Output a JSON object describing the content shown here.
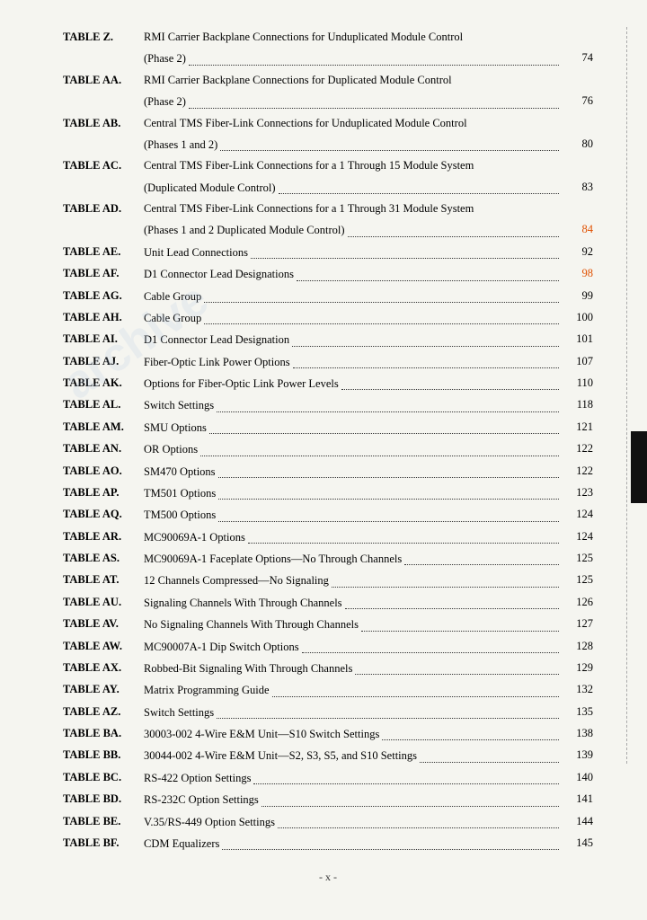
{
  "page": {
    "footer": "- x -",
    "watermark": "archive",
    "entries": [
      {
        "label": "TABLE Z.",
        "desc": "RMI Carrier Backplane Connections for Unduplicated Module Control",
        "desc2": "(Phase 2)",
        "page": "74",
        "highlight": false
      },
      {
        "label": "TABLE AA.",
        "desc": "RMI Carrier Backplane Connections for Duplicated Module Control",
        "desc2": "(Phase 2)",
        "page": "76",
        "highlight": false
      },
      {
        "label": "TABLE AB.",
        "desc": "Central TMS Fiber-Link Connections for Unduplicated Module Control",
        "desc2": "(Phases 1 and 2)",
        "page": "80",
        "highlight": false
      },
      {
        "label": "TABLE AC.",
        "desc": "Central TMS Fiber-Link Connections for a 1 Through 15 Module System",
        "desc2": "(Duplicated Module Control)",
        "page": "83",
        "highlight": false
      },
      {
        "label": "TABLE AD.",
        "desc": "Central TMS Fiber-Link Connections for a 1 Through 31 Module System",
        "desc2": "(Phases 1 and 2 Duplicated Module Control)",
        "page": "84",
        "highlight": true
      },
      {
        "label": "TABLE AE.",
        "desc": "Unit Lead Connections",
        "desc2": null,
        "page": "92",
        "highlight": false
      },
      {
        "label": "TABLE AF.",
        "desc": "D1 Connector Lead Designations",
        "desc2": null,
        "page": "98",
        "highlight": true
      },
      {
        "label": "TABLE AG.",
        "desc": "Cable Group",
        "desc2": null,
        "page": "99",
        "highlight": false
      },
      {
        "label": "TABLE AH.",
        "desc": "Cable Group",
        "desc2": null,
        "page": "100",
        "highlight": false
      },
      {
        "label": "TABLE AI.",
        "desc": "D1 Connector Lead Designation",
        "desc2": null,
        "page": "101",
        "highlight": false
      },
      {
        "label": "TABLE AJ.",
        "desc": "Fiber-Optic Link Power Options",
        "desc2": null,
        "page": "107",
        "highlight": false
      },
      {
        "label": "TABLE AK.",
        "desc": "Options for Fiber-Optic Link Power Levels",
        "desc2": null,
        "page": "110",
        "highlight": false
      },
      {
        "label": "TABLE AL.",
        "desc": "Switch Settings",
        "desc2": null,
        "page": "118",
        "highlight": false
      },
      {
        "label": "TABLE AM.",
        "desc": "SMU Options",
        "desc2": null,
        "page": "121",
        "highlight": false
      },
      {
        "label": "TABLE AN.",
        "desc": "OR Options",
        "desc2": null,
        "page": "122",
        "highlight": false
      },
      {
        "label": "TABLE AO.",
        "desc": "SM470 Options",
        "desc2": null,
        "page": "122",
        "highlight": false
      },
      {
        "label": "TABLE AP.",
        "desc": "TM501 Options",
        "desc2": null,
        "page": "123",
        "highlight": false
      },
      {
        "label": "TABLE AQ.",
        "desc": "TM500 Options",
        "desc2": null,
        "page": "124",
        "highlight": false
      },
      {
        "label": "TABLE AR.",
        "desc": "MC90069A-1 Options",
        "desc2": null,
        "page": "124",
        "highlight": false
      },
      {
        "label": "TABLE AS.",
        "desc": "MC90069A-1 Faceplate Options—No Through Channels",
        "desc2": null,
        "page": "125",
        "highlight": false
      },
      {
        "label": "TABLE AT.",
        "desc": "12 Channels Compressed—No Signaling",
        "desc2": null,
        "page": "125",
        "highlight": false
      },
      {
        "label": "TABLE AU.",
        "desc": "Signaling Channels With Through Channels",
        "desc2": null,
        "page": "126",
        "highlight": false
      },
      {
        "label": "TABLE AV.",
        "desc": "No Signaling Channels With Through Channels",
        "desc2": null,
        "page": "127",
        "highlight": false
      },
      {
        "label": "TABLE AW.",
        "desc": "MC90007A-1 Dip Switch Options",
        "desc2": null,
        "page": "128",
        "highlight": false
      },
      {
        "label": "TABLE AX.",
        "desc": "Robbed-Bit Signaling With Through Channels",
        "desc2": null,
        "page": "129",
        "highlight": false
      },
      {
        "label": "TABLE AY.",
        "desc": "Matrix Programming Guide",
        "desc2": null,
        "page": "132",
        "highlight": false
      },
      {
        "label": "TABLE AZ.",
        "desc": "Switch Settings",
        "desc2": null,
        "page": "135",
        "highlight": false
      },
      {
        "label": "TABLE BA.",
        "desc": "30003-002 4-Wire E&M Unit—S10 Switch Settings",
        "desc2": null,
        "page": "138",
        "highlight": false
      },
      {
        "label": "TABLE BB.",
        "desc": "30044-002 4-Wire E&M Unit—S2, S3, S5, and S10 Settings",
        "desc2": null,
        "page": "139",
        "highlight": false
      },
      {
        "label": "TABLE BC.",
        "desc": "RS-422 Option Settings",
        "desc2": null,
        "page": "140",
        "highlight": false
      },
      {
        "label": "TABLE BD.",
        "desc": "RS-232C Option Settings",
        "desc2": null,
        "page": "141",
        "highlight": false
      },
      {
        "label": "TABLE BE.",
        "desc": "V.35/RS-449 Option Settings",
        "desc2": null,
        "page": "144",
        "highlight": false
      },
      {
        "label": "TABLE BF.",
        "desc": "CDM Equalizers",
        "desc2": null,
        "page": "145",
        "highlight": false
      }
    ]
  }
}
